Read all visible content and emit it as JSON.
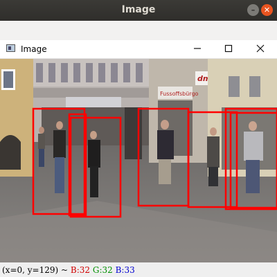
{
  "window": {
    "title": "Image"
  },
  "image_window": {
    "title": "Image"
  },
  "scene": {
    "shop_sign": "Fussoffsbürgo",
    "dm_logo": "dm",
    "detections_count": 7
  },
  "status_bar": {
    "coords": "(x=0, y=129) ~",
    "b": "B:32",
    "g": "G:32",
    "blue": "B:33"
  },
  "colors": {
    "bbox": "#ff0000",
    "ubuntu_close": "#e95420"
  }
}
